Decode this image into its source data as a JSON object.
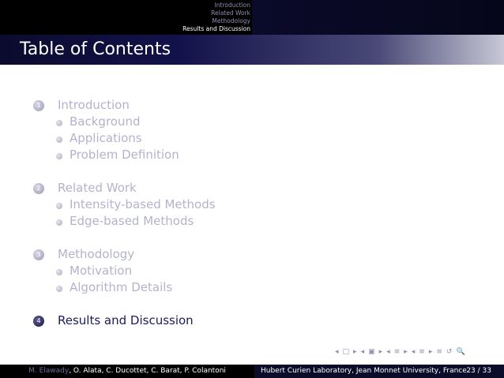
{
  "headline": {
    "sections": [
      {
        "label": "Introduction",
        "active": false
      },
      {
        "label": "Related Work",
        "active": false
      },
      {
        "label": "Methodology",
        "active": false
      },
      {
        "label": "Results and Discussion",
        "active": true
      }
    ]
  },
  "frame": {
    "title": "Table of Contents"
  },
  "toc": {
    "sections": [
      {
        "number": "1",
        "label": "Introduction",
        "active": false,
        "subsections": [
          "Background",
          "Applications",
          "Problem Definition"
        ]
      },
      {
        "number": "2",
        "label": "Related Work",
        "active": false,
        "subsections": [
          "Intensity-based Methods",
          "Edge-based Methods"
        ]
      },
      {
        "number": "3",
        "label": "Methodology",
        "active": false,
        "subsections": [
          "Motivation",
          "Algorithm Details"
        ]
      },
      {
        "number": "4",
        "label": "Results and Discussion",
        "active": true,
        "subsections": []
      }
    ]
  },
  "navigation": {
    "symbols": [
      "◂",
      "□",
      "▸",
      "◂",
      "▣",
      "▸",
      "◂",
      "≡",
      "▸",
      "◂",
      "≡",
      "▸",
      "≡",
      "↺",
      "🔍"
    ]
  },
  "footline": {
    "author_highlight": "M. Elawady",
    "authors_rest": ", O. Alata, C. Ducottet, C. Barat, P. Colantoni",
    "institute": "Hubert Curien Laboratory, Jean Monnet University, France",
    "page": "23 / 33"
  }
}
